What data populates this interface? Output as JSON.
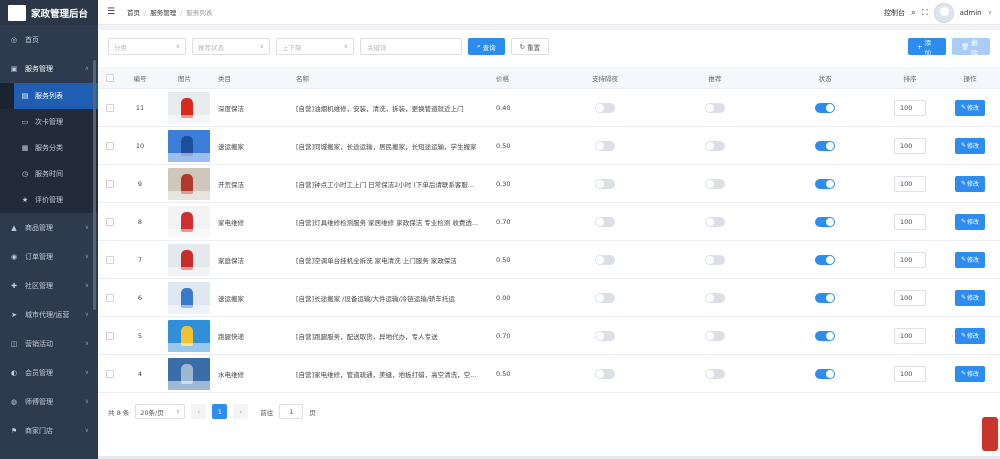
{
  "brand": {
    "title": "家政管理后台"
  },
  "sidebar": {
    "items": [
      {
        "label": "首页",
        "icon": "◎",
        "name": "dashboard"
      },
      {
        "label": "服务管理",
        "icon": "▣",
        "name": "service",
        "open": true,
        "children": [
          {
            "label": "服务列表",
            "icon": "▤",
            "active": true
          },
          {
            "label": "次卡管理",
            "icon": "▭"
          },
          {
            "label": "服务分类",
            "icon": "▦"
          },
          {
            "label": "服务时间",
            "icon": "◷"
          },
          {
            "label": "评价管理",
            "icon": "★"
          }
        ]
      },
      {
        "label": "商品管理",
        "icon": "▲",
        "name": "goods"
      },
      {
        "label": "订单管理",
        "icon": "◉",
        "name": "orders"
      },
      {
        "label": "社区管理",
        "icon": "✚",
        "name": "community"
      },
      {
        "label": "城市代理/运营",
        "icon": "➤",
        "name": "agent"
      },
      {
        "label": "营销活动",
        "icon": "◫",
        "name": "marketing"
      },
      {
        "label": "会员管理",
        "icon": "◐",
        "name": "members"
      },
      {
        "label": "师傅管理",
        "icon": "◍",
        "name": "masters"
      },
      {
        "label": "商家门店",
        "icon": "⚑",
        "name": "stores"
      }
    ]
  },
  "header": {
    "breadcrumb": [
      "首页",
      "服务管理",
      "服务列表"
    ],
    "console": "控制台",
    "user": "admin"
  },
  "filters": {
    "category": "分类",
    "recommend": "推荐状态",
    "shelf": "上下架",
    "keyword_placeholder": "关键词",
    "search": "查询",
    "reset": "重置",
    "add": "添加",
    "delete": "删除"
  },
  "table": {
    "headers": {
      "id": "编号",
      "img": "图片",
      "category": "类目",
      "name": "名称",
      "price": "价格",
      "night": "支持隔夜",
      "recommend": "推荐",
      "status": "状态",
      "sort": "排序",
      "op": "操作"
    },
    "edit_label": "修改",
    "rows": [
      {
        "id": "11",
        "category": "深度保洁",
        "name": "[自营]油烟机维修，安装，清洗，拆装，更换管道就近上门",
        "price": "0.40",
        "night": false,
        "recommend": false,
        "status": true,
        "sort": "100",
        "thumb": [
          "#e9ecef",
          "#d9281e"
        ]
      },
      {
        "id": "10",
        "category": "速运搬家",
        "name": "[自营]同城搬家，长途运输，居民搬家，长短途运输，学生搬家",
        "price": "0.50",
        "night": false,
        "recommend": false,
        "status": true,
        "sort": "100",
        "thumb": [
          "#3b7dd8",
          "#1f4f9a"
        ]
      },
      {
        "id": "9",
        "category": "开荒保洁",
        "name": "[自营]钟点工小时工上门 日常保洁2小时 (下单后请联系客服...",
        "price": "0.30",
        "night": false,
        "recommend": false,
        "status": true,
        "sort": "100",
        "thumb": [
          "#cfc7bb",
          "#b23a2c"
        ]
      },
      {
        "id": "8",
        "category": "家电维修",
        "name": "[自营]灯具维修检测服务 家居维修 家政保洁 专业检测 收费透...",
        "price": "0.70",
        "night": false,
        "recommend": false,
        "status": true,
        "sort": "100",
        "thumb": [
          "#f3f3f3",
          "#d12f2f"
        ]
      },
      {
        "id": "7",
        "category": "家庭保洁",
        "name": "[自营]空调单台挂机全拆洗 家电清洗 上门服务 家政保洁",
        "price": "0.50",
        "night": false,
        "recommend": false,
        "status": true,
        "sort": "100",
        "thumb": [
          "#e5e8ec",
          "#c92a2a"
        ]
      },
      {
        "id": "6",
        "category": "速运搬家",
        "name": "[自营]长途搬家 /设备运输/大件运输/冷链运输/轿车托运",
        "price": "0.00",
        "night": false,
        "recommend": false,
        "status": true,
        "sort": "100",
        "thumb": [
          "#dfe7f2",
          "#3a78c9"
        ]
      },
      {
        "id": "5",
        "category": "跑腿快递",
        "name": "[自营]跑腿服务，配送取货，异地代办，专人专送",
        "price": "0.70",
        "night": false,
        "recommend": false,
        "status": true,
        "sort": "100",
        "thumb": [
          "#2f8fd8",
          "#f2c230"
        ]
      },
      {
        "id": "4",
        "category": "水电维修",
        "name": "[自营]家电维修，管道疏通，美缝，地板打蜡，高空清洗，空...",
        "price": "0.50",
        "night": false,
        "recommend": false,
        "status": true,
        "sort": "100",
        "thumb": [
          "#3a6ea8",
          "#9fb6cf"
        ]
      }
    ]
  },
  "pager": {
    "total": "共 8 条",
    "size": "20条/页",
    "current": "1",
    "goto": "前往",
    "page_unit": "页",
    "jump": "1",
    "prev": "‹",
    "next": "›"
  }
}
